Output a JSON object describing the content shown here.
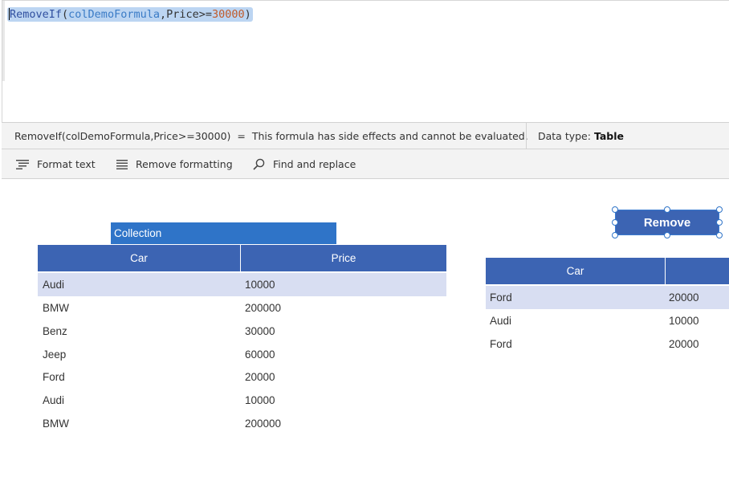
{
  "formula_bar": {
    "tokens": [
      {
        "text": "RemoveIf",
        "kind": "fn"
      },
      {
        "text": "(",
        "kind": "op"
      },
      {
        "text": "colDemoFormula",
        "kind": "var"
      },
      {
        "text": ",Price>=",
        "kind": "op"
      },
      {
        "text": "30000",
        "kind": "num"
      },
      {
        "text": ")",
        "kind": "op"
      }
    ]
  },
  "status": {
    "formula_text": "RemoveIf(colDemoFormula,Price>=30000)",
    "equals": "=",
    "message": "This formula has side effects and cannot be evaluated.",
    "data_type_label": "Data type:",
    "data_type_value": "Table"
  },
  "toolbar": {
    "format_text": "Format text",
    "remove_formatting": "Remove formatting",
    "find_replace": "Find and replace"
  },
  "collection_label": "Collection",
  "left_table": {
    "columns": [
      "Car",
      "Price"
    ],
    "rows": [
      [
        "Audi",
        "10000"
      ],
      [
        "BMW",
        "200000"
      ],
      [
        "Benz",
        "30000"
      ],
      [
        "Jeep",
        "60000"
      ],
      [
        "Ford",
        "20000"
      ],
      [
        "Audi",
        "10000"
      ],
      [
        "BMW",
        "200000"
      ]
    ]
  },
  "remove_button": "Remove",
  "right_table": {
    "columns": [
      "Car",
      ""
    ],
    "rows": [
      [
        "Ford",
        "20000"
      ],
      [
        "Audi",
        "10000"
      ],
      [
        "Ford",
        "20000"
      ]
    ]
  },
  "colors": {
    "accent": "#3c64b3",
    "collection_label_bg": "#2f74c8",
    "selected_row": "#d8def2"
  }
}
